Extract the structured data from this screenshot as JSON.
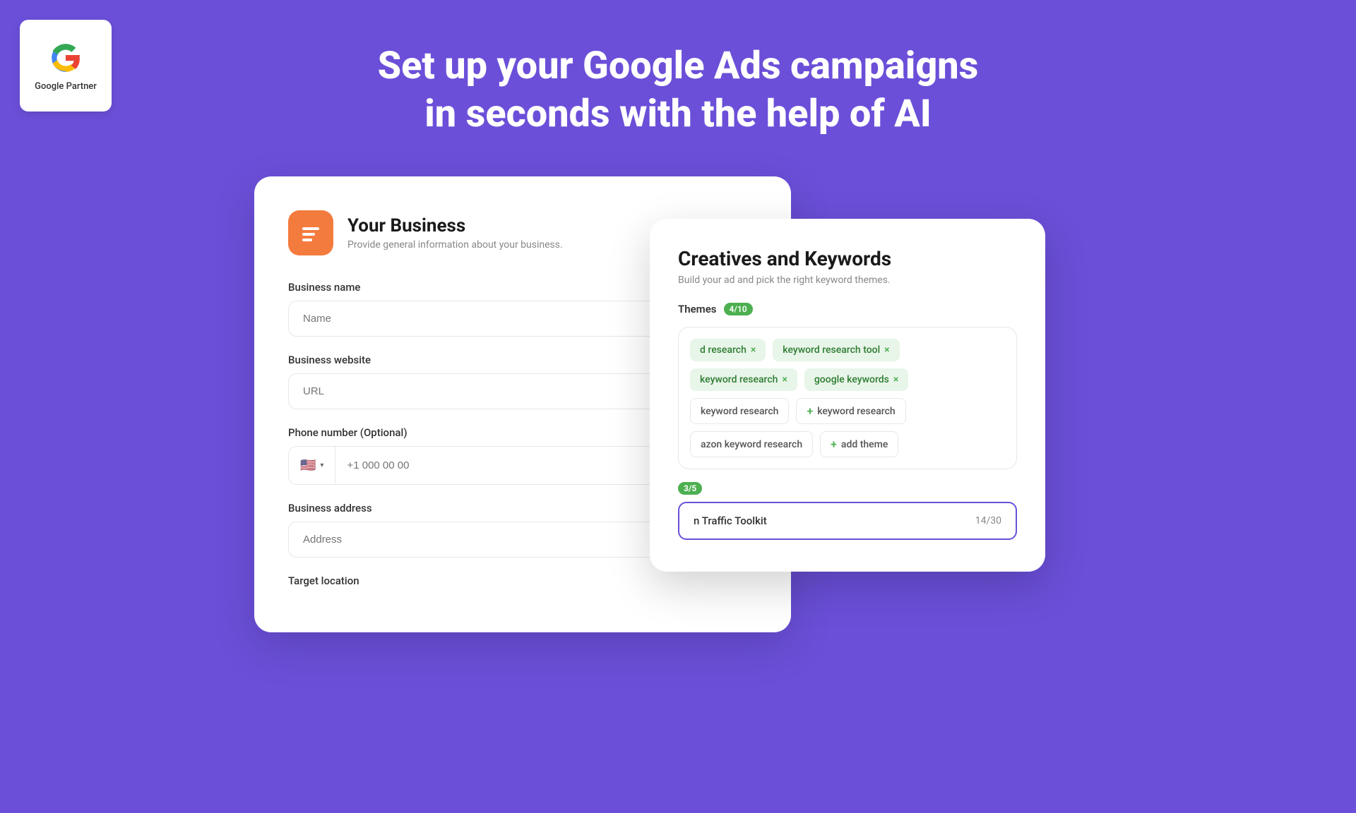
{
  "hero": {
    "title_line1": "Set up your Google Ads campaigns",
    "title_line2": "in seconds with the help of AI"
  },
  "google_partner": {
    "text": "Google Partner"
  },
  "business_card": {
    "title": "Your Business",
    "subtitle": "Provide general information about your business.",
    "fields": {
      "business_name_label": "Business name",
      "business_name_placeholder": "Name",
      "business_website_label": "Business website",
      "business_website_placeholder": "URL",
      "phone_label": "Phone number (Optional)",
      "phone_placeholder": "+1 000 00 00",
      "address_label": "Business address",
      "address_placeholder": "Address",
      "location_label": "Target location"
    }
  },
  "keywords_card": {
    "title": "Creatives and Keywords",
    "subtitle": "Build your ad and pick the right keyword themes.",
    "themes_label": "hemes",
    "themes_badge": "4/10",
    "tags_green": [
      {
        "text": "d research",
        "removable": true
      },
      {
        "text": "keyword research tool",
        "removable": true
      },
      {
        "text": "keyword research",
        "removable": true
      },
      {
        "text": "google keywords",
        "removable": true
      }
    ],
    "tags_outline": [
      {
        "text": "keyword research",
        "add": false
      },
      {
        "text": "keyword research",
        "add": true
      },
      {
        "text": "azon keyword research",
        "add": false
      },
      {
        "text": "add theme",
        "add": true
      }
    ],
    "counter_badge": "3/5",
    "toolkit_name": "n Traffic Toolkit",
    "toolkit_count": "14/30"
  }
}
